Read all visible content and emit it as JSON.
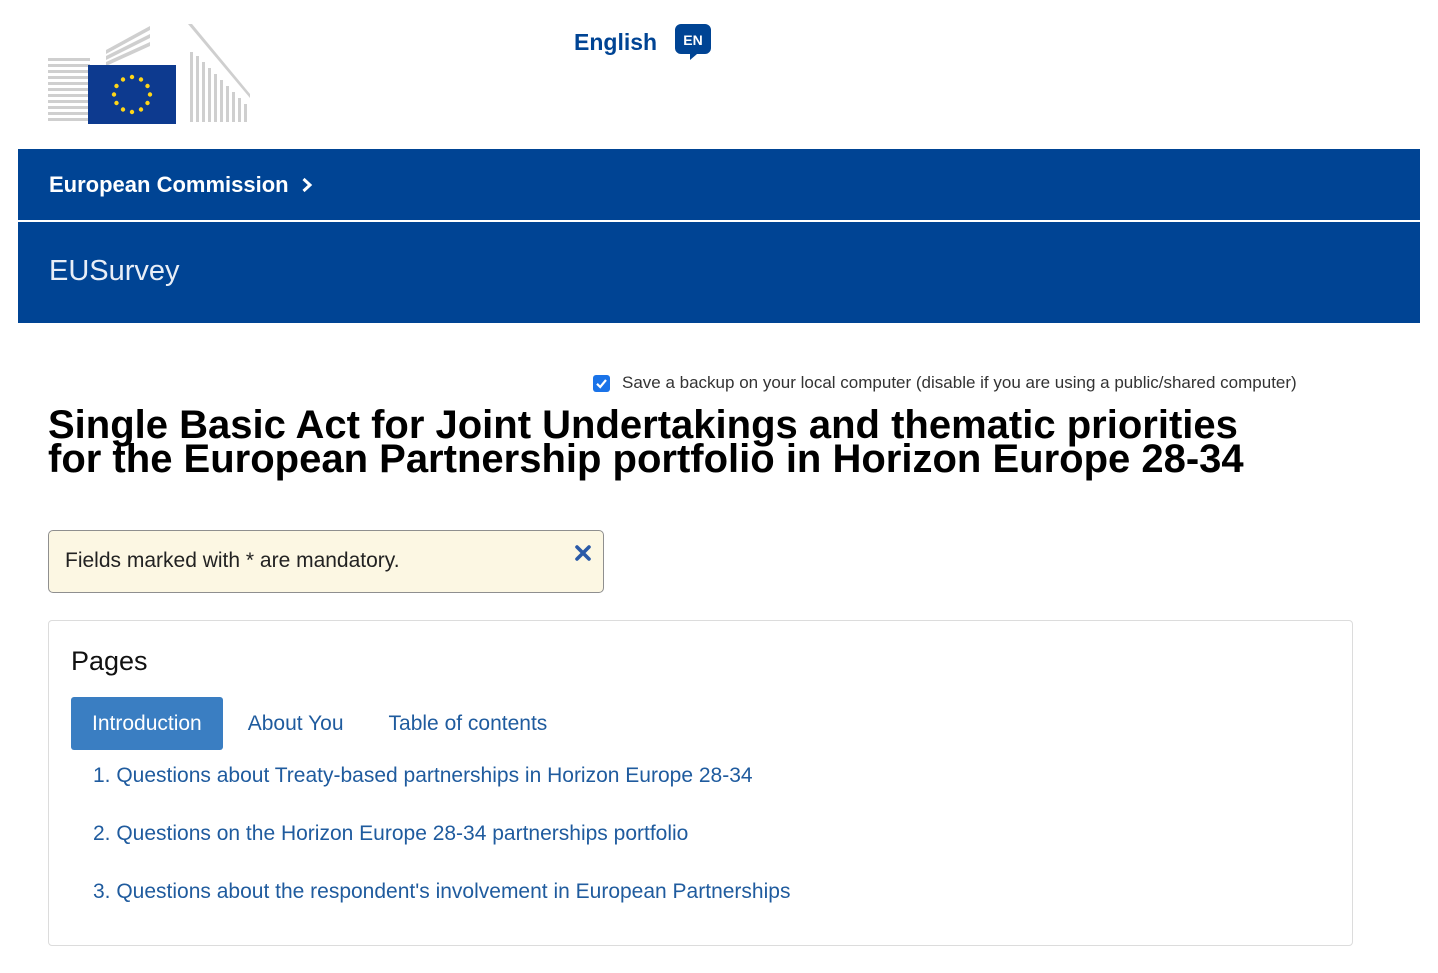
{
  "header": {
    "logo_alt": "European Commission",
    "language": {
      "label": "English",
      "code": "EN"
    }
  },
  "banner": {
    "breadcrumb": "European Commission",
    "site_name": "EUSurvey"
  },
  "backup": {
    "checked": true,
    "label": "Save a backup on your local computer (disable if you are using a public/shared computer)"
  },
  "survey": {
    "title_line1": "Single Basic Act for Joint Undertakings and thematic priorities",
    "title_line2": "for the European Partnership portfolio in Horizon Europe 28-34"
  },
  "notice": {
    "text": "Fields marked with * are mandatory."
  },
  "pages": {
    "heading": "Pages",
    "tabs": [
      {
        "label": "Introduction",
        "active": true
      },
      {
        "label": "About You",
        "active": false
      },
      {
        "label": "Table of contents",
        "active": false
      }
    ],
    "sections": [
      {
        "label": "1. Questions about Treaty-based partnerships in Horizon Europe 28-34"
      },
      {
        "label": "2. Questions on the Horizon Europe 28-34 partnerships portfolio"
      },
      {
        "label": "3. Questions about the respondent's involvement in European Partnerships"
      }
    ]
  },
  "colors": {
    "brand_blue": "#004494",
    "tab_active": "#3a7ec2",
    "link": "#1f5b9e",
    "notice_bg": "#fcf7e3"
  },
  "icons": {
    "logo": "eu-flag-logo",
    "language": "speech-bubble-icon",
    "breadcrumb": "chevron-right-icon",
    "checkbox": "checkmark-icon",
    "close": "close-icon"
  }
}
